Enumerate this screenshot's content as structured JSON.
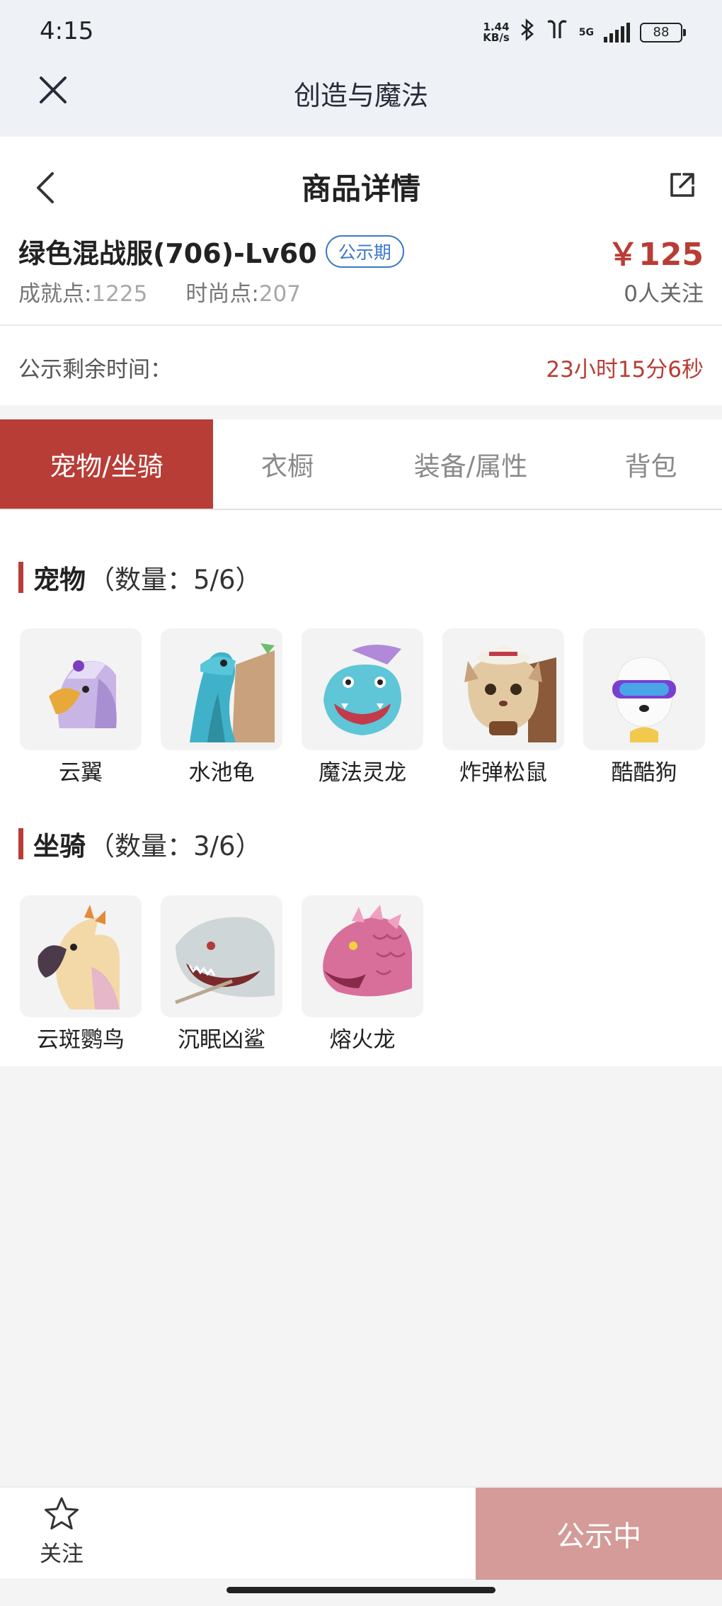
{
  "status": {
    "time": "4:15",
    "speed_value": "1.44",
    "speed_unit": "KB/s",
    "network": "5G",
    "battery": "88"
  },
  "app": {
    "title": "创造与魔法",
    "close_icon": "close-icon"
  },
  "header": {
    "title": "商品详情",
    "back_icon": "chevron-left-icon",
    "share_icon": "share-icon"
  },
  "product": {
    "name": "绿色混战服(706)-Lv60",
    "badge": "公示期",
    "price": "￥125",
    "achievement_label": "成就点:",
    "achievement_value": "1225",
    "fashion_label": "时尚点:",
    "fashion_value": "207",
    "followers": "0人关注"
  },
  "timer": {
    "label": "公示剩余时间：",
    "value": "23小时15分6秒"
  },
  "tabs": [
    {
      "label": "宠物/坐骑",
      "active": true
    },
    {
      "label": "衣橱",
      "active": false
    },
    {
      "label": "装备/属性",
      "active": false
    },
    {
      "label": "背包",
      "active": false
    }
  ],
  "pets": {
    "title": "宠物",
    "count": "（数量：5/6）",
    "items": [
      {
        "name": "云翼",
        "icon": "griffin-icon"
      },
      {
        "name": "水池龟",
        "icon": "turtle-icon"
      },
      {
        "name": "魔法灵龙",
        "icon": "dragon-icon"
      },
      {
        "name": "炸弹松鼠",
        "icon": "squirrel-icon"
      },
      {
        "name": "酷酷狗",
        "icon": "dog-icon"
      }
    ]
  },
  "mounts": {
    "title": "坐骑",
    "count": "（数量：3/6）",
    "items": [
      {
        "name": "云斑鹦鸟",
        "icon": "parrot-icon"
      },
      {
        "name": "沉眠凶鲨",
        "icon": "shark-icon"
      },
      {
        "name": "熔火龙",
        "icon": "fire-dragon-icon"
      }
    ]
  },
  "bottom": {
    "follow_label": "关注",
    "cta_label": "公示中"
  },
  "colors": {
    "accent": "#b83d36",
    "badge": "#3d78c9",
    "cta": "#d49b98"
  }
}
